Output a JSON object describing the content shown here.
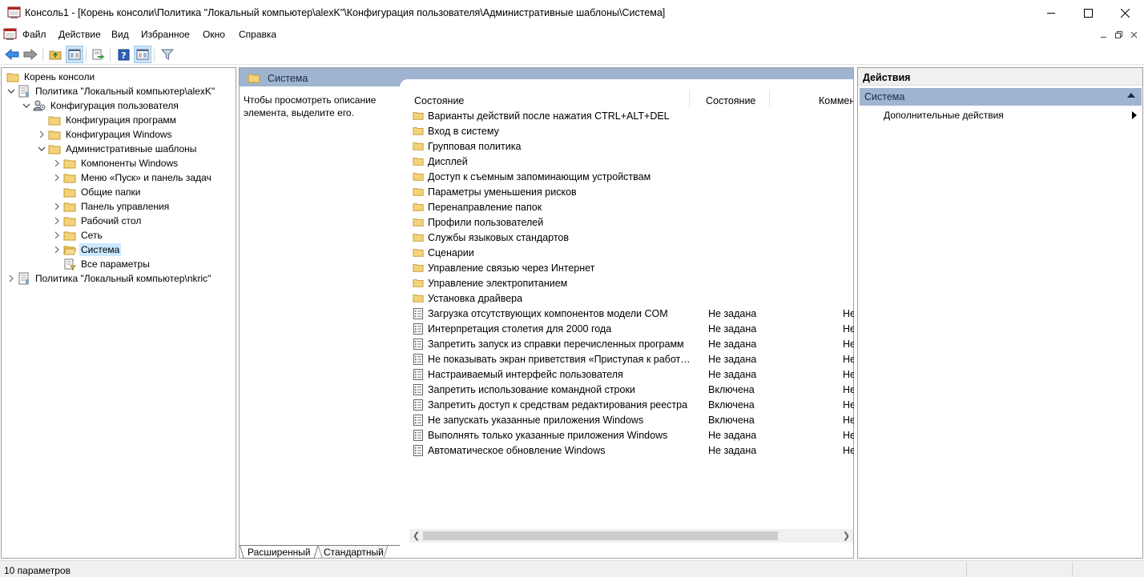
{
  "window": {
    "title": "Консоль1 - [Корень консоли\\Политика \"Локальный компьютер\\alexK\"\\Конфигурация пользователя\\Административные шаблоны\\Система]"
  },
  "menu": {
    "items": [
      "Файл",
      "Действие",
      "Вид",
      "Избранное",
      "Окно",
      "Справка"
    ]
  },
  "toolbar": {
    "buttons": [
      "back-icon",
      "forward-icon",
      "up-folder-icon",
      "show-hide-tree-icon",
      "export-list-icon",
      "help-icon",
      "action-pane-icon",
      "filter-icon"
    ]
  },
  "tree": {
    "items": [
      {
        "label": "Корень консоли"
      },
      {
        "label": "Политика \"Локальный компьютер\\alexK\""
      },
      {
        "label": "Конфигурация пользователя"
      },
      {
        "label": "Конфигурация программ"
      },
      {
        "label": "Конфигурация Windows"
      },
      {
        "label": "Административные шаблоны"
      },
      {
        "label": "Компоненты Windows"
      },
      {
        "label": "Меню «Пуск» и панель задач"
      },
      {
        "label": "Общие папки"
      },
      {
        "label": "Панель управления"
      },
      {
        "label": "Рабочий стол"
      },
      {
        "label": "Сеть"
      },
      {
        "label": "Система"
      },
      {
        "label": "Все параметры"
      },
      {
        "label": "Политика \"Локальный компьютер\\nkric\""
      }
    ]
  },
  "main": {
    "header_title": "Система",
    "description": "Чтобы просмотреть описание элемента, выделите его.",
    "columns": [
      "Состояние",
      "Состояние",
      "Коммен"
    ],
    "folders": [
      "Варианты действий после нажатия CTRL+ALT+DEL",
      "Вход в систему",
      "Групповая политика",
      "Дисплей",
      "Доступ к съемным запоминающим устройствам",
      "Параметры уменьшения рисков",
      "Перенаправление папок",
      "Профили пользователей",
      "Службы языковых стандартов",
      "Сценарии",
      "Управление связью через Интернет",
      "Управление электропитанием",
      "Установка драйвера"
    ],
    "settings": [
      {
        "name": "Загрузка отсутствующих компонентов модели COM",
        "state": "Не задана",
        "comment": "Не"
      },
      {
        "name": "Интерпретация столетия для 2000 года",
        "state": "Не задана",
        "comment": "Не"
      },
      {
        "name": "Запретить запуск из справки перечисленных программ",
        "state": "Не задана",
        "comment": "Не"
      },
      {
        "name": "Не показывать экран приветствия «Приступая к работе» ...",
        "state": "Не задана",
        "comment": "Не"
      },
      {
        "name": "Настраиваемый интерфейс пользователя",
        "state": "Не задана",
        "comment": "Не"
      },
      {
        "name": "Запретить использование командной строки",
        "state": "Включена",
        "comment": "Не"
      },
      {
        "name": "Запретить доступ к средствам редактирования реестра",
        "state": "Включена",
        "comment": "Не"
      },
      {
        "name": "Не запускать указанные приложения Windows",
        "state": "Включена",
        "comment": "Не"
      },
      {
        "name": "Выполнять только указанные приложения Windows",
        "state": "Не задана",
        "comment": "Не"
      },
      {
        "name": "Автоматическое обновление Windows",
        "state": "Не задана",
        "comment": "Не"
      }
    ],
    "tabs": [
      "Расширенный",
      "Стандартный"
    ]
  },
  "actions": {
    "header": "Действия",
    "group": "Система",
    "item": "Дополнительные действия"
  },
  "status": {
    "text": "10 параметров"
  },
  "colors": {
    "header_blue": "#9fb4d0",
    "folder_yellow": "#e8c15a",
    "selection": "#cce8ff"
  }
}
